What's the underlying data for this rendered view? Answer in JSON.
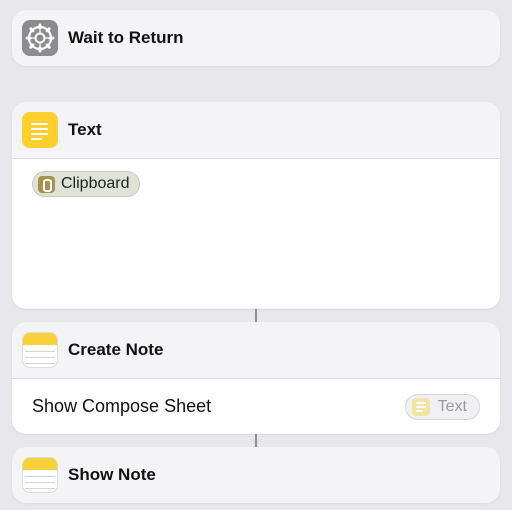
{
  "actions": {
    "wait": {
      "title": "Wait to Return",
      "icon": "settings-gear-icon"
    },
    "text": {
      "title": "Text",
      "icon": "text-lines-icon",
      "variable_token": {
        "label": "Clipboard",
        "icon": "clipboard-icon"
      }
    },
    "create_note": {
      "title": "Create Note",
      "icon": "notes-app-icon",
      "param_label": "Show Compose Sheet",
      "param_token": {
        "label": "Text",
        "icon": "text-lines-icon"
      }
    },
    "show_note": {
      "title": "Show Note",
      "icon": "notes-app-icon"
    }
  },
  "colors": {
    "background": "#e7e7ec",
    "card": "#f4f4f7",
    "text_icon": "#fdd02f",
    "settings_icon": "#8c8c90",
    "notes_header": "#f9cf3a"
  }
}
